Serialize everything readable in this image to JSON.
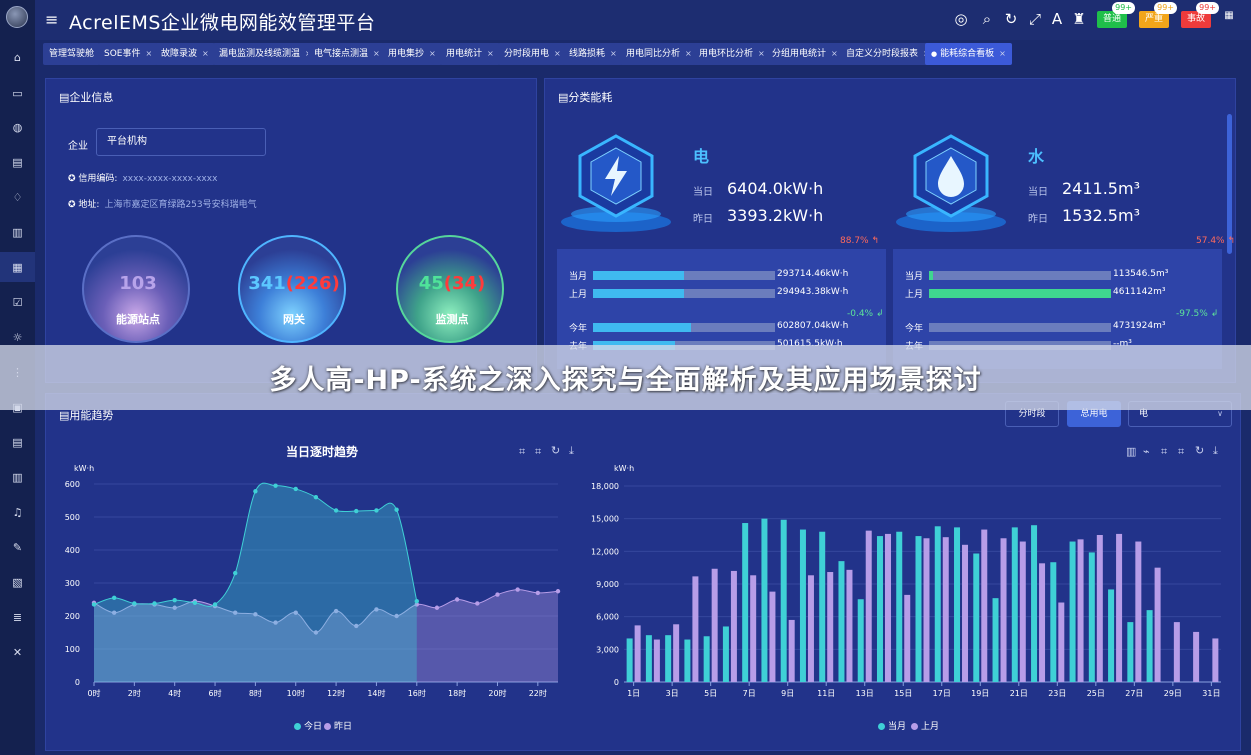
{
  "header": {
    "title": "AcrelEMS企业微电网能效管理平台",
    "alarms": [
      {
        "label": "普通",
        "count": "99+",
        "color": "#1fbf4a"
      },
      {
        "label": "严重",
        "count": "99+",
        "color": "#f2a51a"
      },
      {
        "label": "事故",
        "count": "99+",
        "color": "#ee3b3b"
      }
    ]
  },
  "tabs": [
    "管理驾驶舱",
    "SOE事件",
    "故障录波",
    "漏电监测及线缆测温",
    "电气接点测温",
    "用电集抄",
    "用电统计",
    "分时段用电",
    "线路损耗",
    "用电同比分析",
    "用电环比分析",
    "分组用电统计",
    "自定义分时段报表",
    "能耗综合看板"
  ],
  "enterprise": {
    "title": "企业信息",
    "company_label": "企业",
    "company_value": "平台机构",
    "credit_label": "信用编码:",
    "credit_value": "xxxx-xxxx-xxxx-xxxx",
    "address_label": "地址:",
    "address_value": "上海市嘉定区育绿路253号安科瑞电气",
    "stats": [
      {
        "value": "103",
        "label": "能源站点"
      },
      {
        "value": "341",
        "value_extra": "(226)",
        "label": "网关"
      },
      {
        "value": "45",
        "value_extra": "(34)",
        "label": "监测点"
      }
    ]
  },
  "energy": {
    "title": "分类能耗",
    "items": [
      {
        "name": "电",
        "today_label": "当日",
        "today_value": "6404.0kW·h",
        "yesterday_label": "昨日",
        "yesterday_value": "3393.2kW·h",
        "day_change": "88.7%",
        "month_label": "当月",
        "month_value": "293714.46kW·h",
        "month_level": 0.5,
        "lastmonth_label": "上月",
        "lastmonth_value": "294943.38kW·h",
        "lastmonth_level": 0.5,
        "month_change": "-0.4%",
        "year_label": "今年",
        "year_value": "602807.04kW·h",
        "year_level": 0.54,
        "lastyear_label": "去年",
        "lastyear_value": "501615.5kW·h",
        "lastyear_level": 0.45
      },
      {
        "name": "水",
        "today_label": "当日",
        "today_value": "2411.5m³",
        "yesterday_label": "昨日",
        "yesterday_value": "1532.5m³",
        "day_change": "57.4%",
        "month_label": "当月",
        "month_value": "113546.5m³",
        "month_level": 0.02,
        "lastmonth_label": "上月",
        "lastmonth_value": "4611142m³",
        "lastmonth_level": 1.0,
        "month_change": "-97.5%",
        "year_label": "今年",
        "year_value": "4731924m³",
        "year_level": 0,
        "lastyear_label": "去年",
        "lastyear_value": "--m³",
        "lastyear_level": 0
      }
    ]
  },
  "trend": {
    "title": "用能趋势",
    "btn_period": "分时段",
    "btn_total": "总用电",
    "select_value": "电"
  },
  "banner": {
    "text": "多人高-HP-系统之深入探究与全面解析及其应用场景探讨"
  },
  "colors": {
    "today": "#3fd0d6",
    "yesterday": "#b79de8"
  },
  "chart_data": [
    {
      "type": "area",
      "title": "当日逐时趋势",
      "ylabel": "kW·h",
      "ylim": [
        0,
        600
      ],
      "yticks": [
        0,
        100,
        200,
        300,
        400,
        500,
        600
      ],
      "x": [
        "0时",
        "1时",
        "2时",
        "3时",
        "4时",
        "5时",
        "6时",
        "7时",
        "8时",
        "9时",
        "10时",
        "11时",
        "12时",
        "13时",
        "14时",
        "15时",
        "16时",
        "17时",
        "18时",
        "19时",
        "20时",
        "21时",
        "22时",
        "23时"
      ],
      "xtick_labels": [
        "0时",
        "2时",
        "4时",
        "6时",
        "8时",
        "10时",
        "12时",
        "14时",
        "16时",
        "18时",
        "20时",
        "22时"
      ],
      "series": [
        {
          "name": "今日",
          "values": [
            235,
            255,
            238,
            238,
            248,
            240,
            235,
            330,
            578,
            595,
            585,
            560,
            520,
            518,
            520,
            522,
            245,
            null,
            null,
            null,
            null,
            null,
            null,
            null
          ]
        },
        {
          "name": "昨日",
          "values": [
            240,
            210,
            235,
            235,
            225,
            245,
            230,
            210,
            205,
            180,
            210,
            150,
            215,
            170,
            220,
            200,
            235,
            225,
            250,
            238,
            265,
            280,
            270,
            275
          ]
        }
      ],
      "legend": "bottom-center"
    },
    {
      "type": "bar",
      "ylabel": "kW·h",
      "ylim": [
        0,
        18000
      ],
      "yticks": [
        0,
        3000,
        6000,
        9000,
        12000,
        15000,
        18000
      ],
      "categories": [
        "1日",
        "2日",
        "3日",
        "4日",
        "5日",
        "6日",
        "7日",
        "8日",
        "9日",
        "10日",
        "11日",
        "12日",
        "13日",
        "14日",
        "15日",
        "16日",
        "17日",
        "18日",
        "19日",
        "20日",
        "21日",
        "22日",
        "23日",
        "24日",
        "25日",
        "26日",
        "27日",
        "28日",
        "29日",
        "30日",
        "31日"
      ],
      "xtick_labels": [
        "1日",
        "3日",
        "5日",
        "7日",
        "9日",
        "11日",
        "13日",
        "15日",
        "17日",
        "19日",
        "21日",
        "23日",
        "25日",
        "27日",
        "29日",
        "31日"
      ],
      "series": [
        {
          "name": "当月",
          "values": [
            4000,
            4300,
            4300,
            3900,
            4200,
            5100,
            14600,
            15000,
            14900,
            14000,
            13800,
            11100,
            7600,
            13400,
            13800,
            13400,
            14300,
            14200,
            11800,
            7700,
            14200,
            14400,
            11000,
            12900,
            11900,
            8500,
            5500,
            6600,
            0,
            0,
            0
          ]
        },
        {
          "name": "上月",
          "values": [
            5200,
            3900,
            5300,
            9700,
            10400,
            10200,
            9800,
            8300,
            5700,
            9800,
            10100,
            10300,
            13900,
            13600,
            8000,
            13200,
            13300,
            12600,
            14000,
            13200,
            12900,
            10900,
            7300,
            13100,
            13500,
            13600,
            12900,
            10500,
            5500,
            4600,
            4000
          ]
        }
      ],
      "legend": "bottom-center"
    }
  ]
}
